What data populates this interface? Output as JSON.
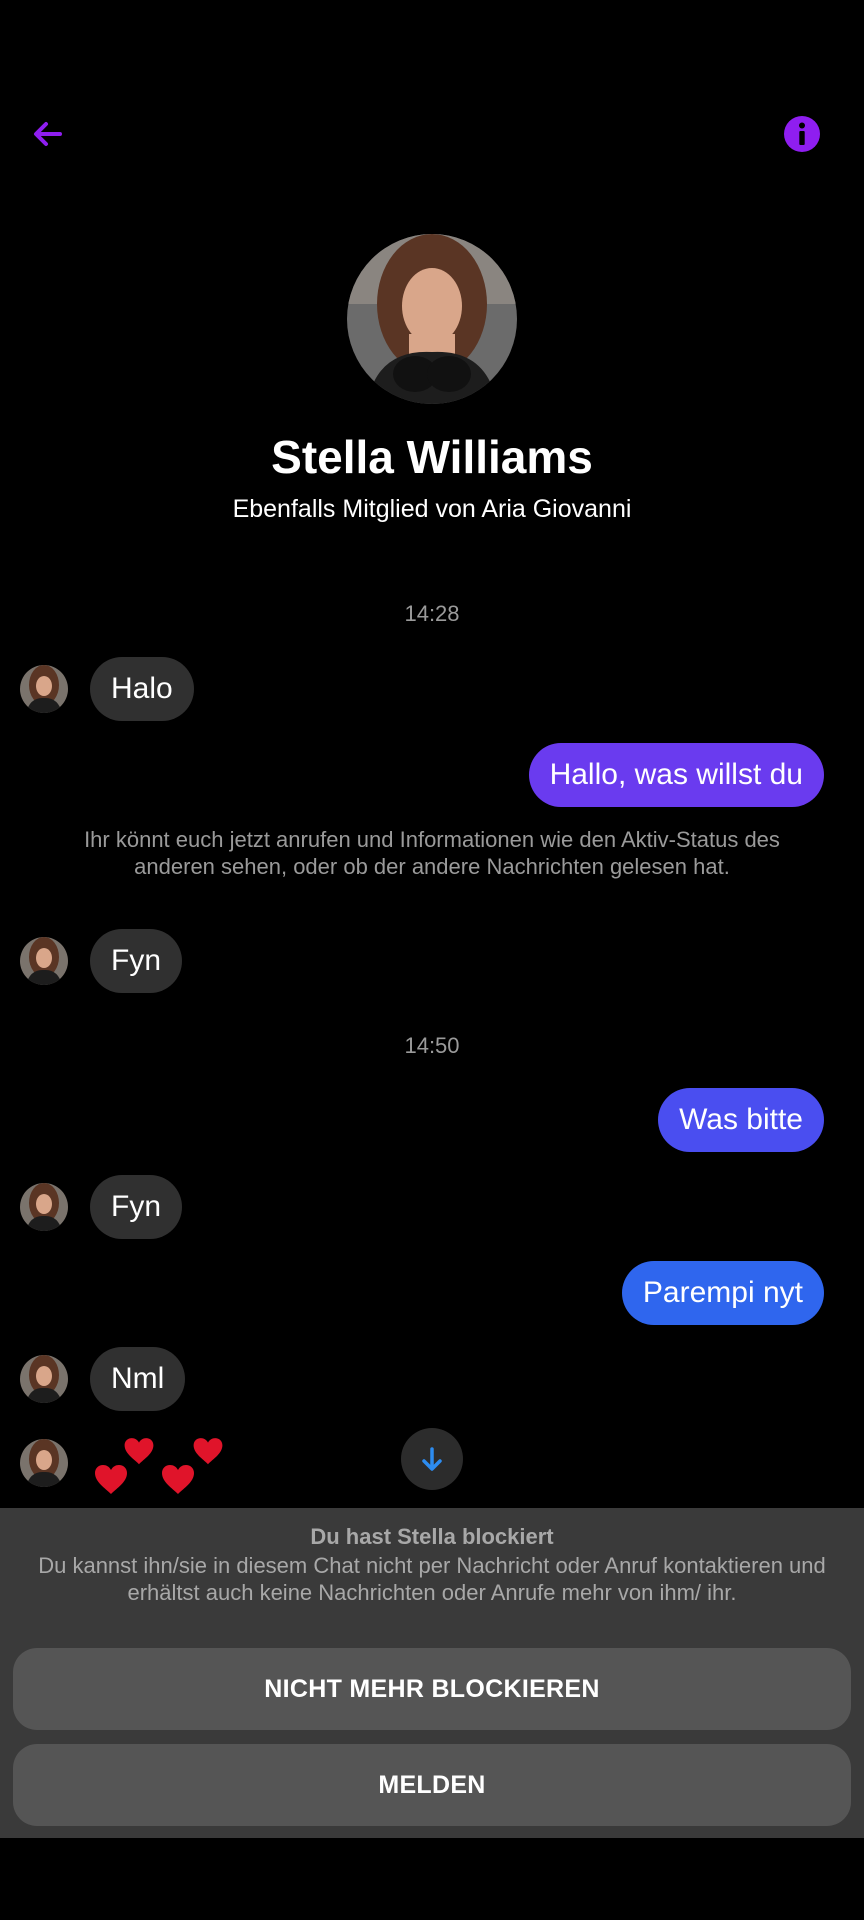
{
  "header": {
    "back_icon": "arrow-left-icon",
    "info_icon": "info-icon",
    "accent": "#8f1ef0"
  },
  "profile": {
    "name": "Stella Williams",
    "subtitle": "Ebenfalls Mitglied von Aria Giovanni"
  },
  "chat": {
    "timestamps": [
      "14:28",
      "14:50"
    ],
    "system_message": "Ihr könnt euch jetzt anrufen und Informationen wie den Aktiv-Status des anderen sehen, oder ob der andere Nachrichten gelesen hat.",
    "messages": [
      {
        "from": "them",
        "text": "Halo"
      },
      {
        "from": "me",
        "text": "Hallo, was willst du",
        "color": "#6a3bef"
      },
      {
        "from": "them",
        "text": "Fyn"
      },
      {
        "from": "me",
        "text": "Was bitte",
        "color": "#4a4ef0"
      },
      {
        "from": "them",
        "text": "Fyn"
      },
      {
        "from": "me",
        "text": "Parempi nyt",
        "color": "#2f66ee"
      },
      {
        "from": "them",
        "text": "Nml"
      },
      {
        "from": "them",
        "text": "❤️❤️❤️❤️",
        "type": "emoji"
      }
    ]
  },
  "blocked_panel": {
    "title": "Du hast Stella blockiert",
    "text": "Du kannst ihn/sie in diesem Chat nicht per Nachricht oder Anruf kontaktieren und erhältst auch keine Nachrichten oder Anrufe mehr von ihm/ ihr.",
    "unblock_label": "NICHT MEHR BLOCKIEREN",
    "report_label": "MELDEN"
  }
}
